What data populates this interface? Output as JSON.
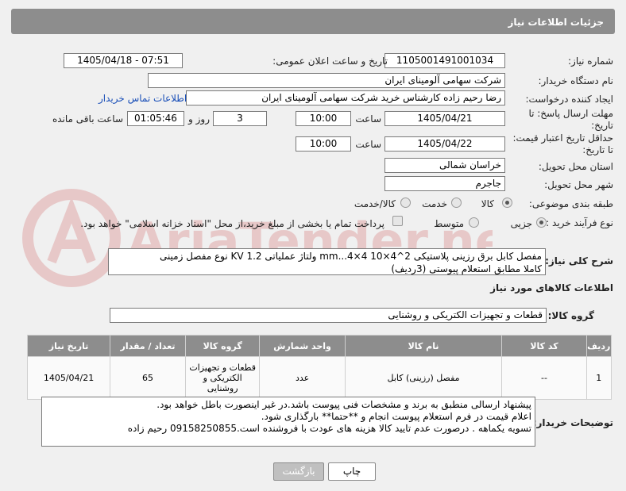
{
  "header": {
    "title": "جزئیات اطلاعات نیاز"
  },
  "labels": {
    "need_number": "شماره نیاز:",
    "announce_datetime": "تاریخ و ساعت اعلان عمومی:",
    "buyer_org": "نام دستگاه خریدار:",
    "requester": "ایجاد کننده درخواست:",
    "reply_deadline": "مهلت ارسال پاسخ: تا تاریخ:",
    "price_validity": "حداقل تاریخ اعتبار قیمت: تا تاریخ:",
    "time": "ساعت",
    "days_and": "روز و",
    "time_remaining": "ساعت باقی مانده",
    "province": "استان محل تحویل:",
    "city": "شهر محل تحویل:",
    "category": "طبقه بندی موضوعی:",
    "process_type": "نوع فرآیند خرید :",
    "general_desc": "شرح کلی نیاز:",
    "goods_info": "اطلاعات کالاهای مورد نیاز",
    "goods_group": "گروه کالا:",
    "buyer_notes": "توضیحات خریدار:"
  },
  "values": {
    "need_number": "1105001491001034",
    "announce_datetime": "1405/04/18 - 07:51",
    "buyer_org": "شرکت سهامی آلومینای ایران",
    "requester": "رضا رحیم زاده کارشناس خرید شرکت سهامی آلومینای ایران",
    "buyer_contact_link": "اطلاعات تماس خریدار",
    "reply_date": "1405/04/21",
    "reply_time": "10:00",
    "reply_days": "3",
    "reply_remaining": "01:05:46",
    "validity_date": "1405/04/22",
    "validity_time": "10:00",
    "province": "خراسان شمالی",
    "city": "جاجرم",
    "goods_group": "قطعات و تجهیزات الکتریکی و روشنایی"
  },
  "category_options": {
    "goods": "کالا",
    "service": "خدمت",
    "goods_service": "کالا/خدمت"
  },
  "process_options": {
    "minor": "جزیی",
    "medium": "متوسط",
    "treasury_note": "پرداخت تمام یا بخشی از مبلغ خرید،از محل \"اسناد خزانه اسلامی\" خواهد بود."
  },
  "general_desc_lines": [
    "مفصل کابل برق رزینی پلاستیکی 2^4×10 mm...4×4 ولتاژ عملیاتی 1.2 KV نوع مفصل زمینی",
    "کاملا مطابق استعلام پیوستی (3ردیف)"
  ],
  "table": {
    "headers": [
      "ردیف",
      "کد کالا",
      "نام کالا",
      "واحد شمارش",
      "گروه کالا",
      "تعداد / مقدار",
      "تاریخ نیاز"
    ],
    "rows": [
      [
        "1",
        "--",
        "مفصل (رزینی) کابل",
        "عدد",
        "قطعات و تجهیزات الکتریکی و روشنایی",
        "65",
        "1405/04/21"
      ]
    ]
  },
  "buyer_notes_lines": [
    "پیشنهاد ارسالی منطبق به برند و مشخصات فنی پیوست باشد.در غیر اینصورت باطل خواهد بود.",
    "اعلام قیمت در فرم استعلام پیوست انجام و **حتما** بارگذاری شود.",
    "تسویه یکماهه . درصورت عدم تایید کالا هزینه های عودت با فروشنده است.09158250855 رحیم زاده"
  ],
  "buttons": {
    "print": "چاپ",
    "back": "بازگشت"
  },
  "colors": {
    "header_bg": "#8d8d8d",
    "link": "#1a4fb8",
    "page_bg": "#f0f0f0"
  },
  "watermark": "AriaTender.net"
}
